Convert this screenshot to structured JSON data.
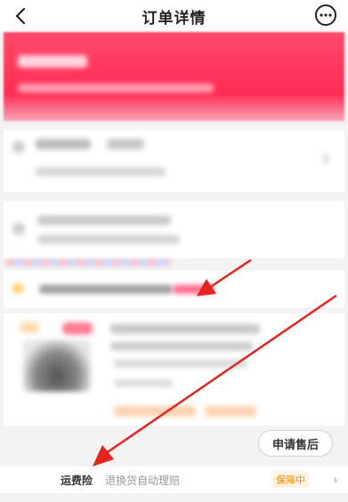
{
  "header": {
    "title": "订单详情",
    "back_icon": "chevron-left-icon",
    "more_icon": "ellipsis-circle-icon"
  },
  "actions": {
    "after_sales_label": "申请售后"
  },
  "insurance": {
    "label": "运费险",
    "description": "退换货自动理赔",
    "status": "保障中",
    "chevron_icon": "chevron-right-icon"
  },
  "colors": {
    "banner": "#ff2d55",
    "annotation_arrow": "#e8231e",
    "insurance_status": "#ff8a00"
  }
}
